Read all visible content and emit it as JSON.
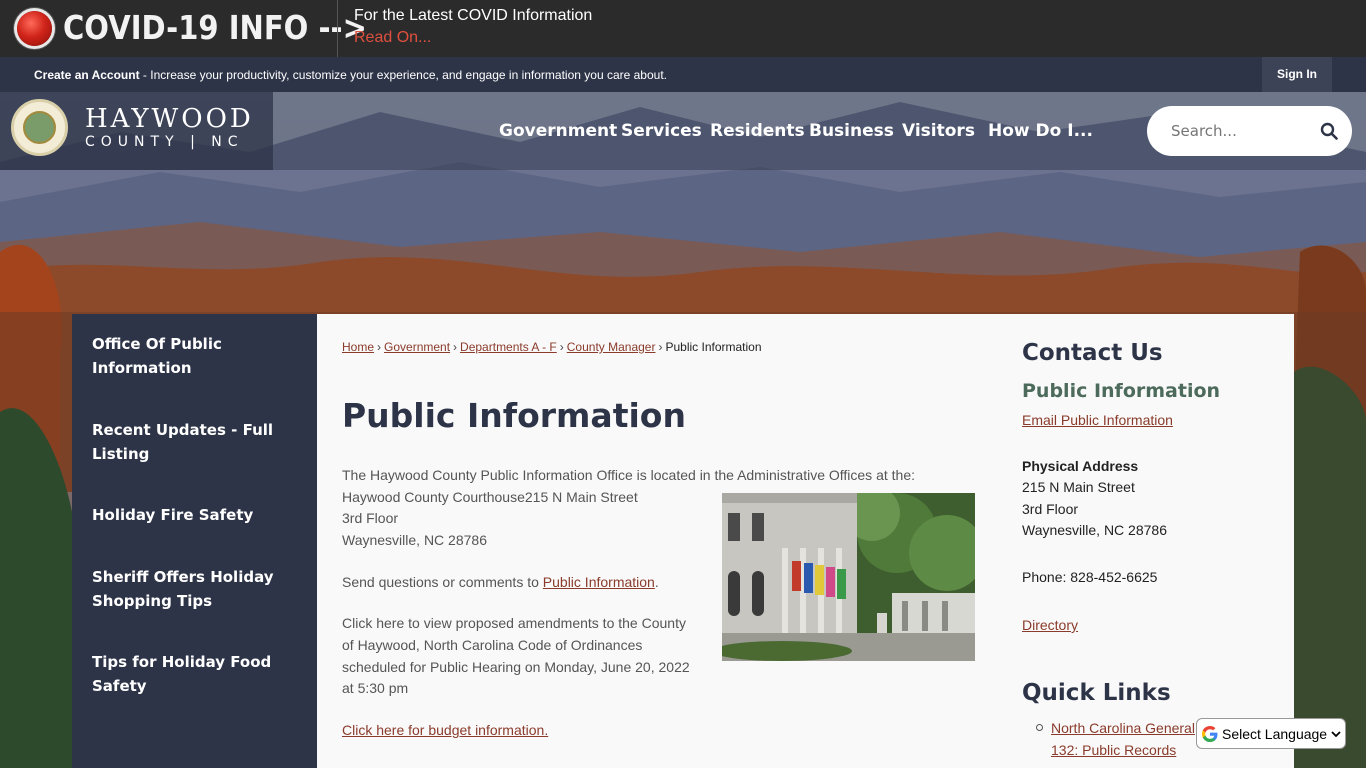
{
  "covid_banner": {
    "title": "COVID-19 INFO -->",
    "message": "For the Latest COVID Information",
    "read_on": "Read On..."
  },
  "account_bar": {
    "create_link": "Create an Account",
    "description": " - Increase your productivity, customize your experience, and engage in information you care about.",
    "sign_in": "Sign In"
  },
  "logo": {
    "name": "HAYWOOD",
    "subtitle": "COUNTY | NC"
  },
  "nav": {
    "items": [
      "Government",
      "Services",
      "Residents",
      "Business",
      "Visitors",
      "How Do I..."
    ]
  },
  "search": {
    "placeholder": "Search..."
  },
  "sidebar": {
    "items": [
      "Office Of Public Information",
      "Recent Updates - Full Listing",
      "Holiday Fire Safety",
      "Sheriff Offers Holiday Shopping Tips",
      "Tips for Holiday Food Safety"
    ]
  },
  "breadcrumb": {
    "items": [
      "Home",
      "Government",
      "Departments A - F",
      "County Manager"
    ],
    "current": "Public Information"
  },
  "main": {
    "title": "Public Information",
    "intro": "The Haywood County Public Information Office is located in the Administrative Offices at the:",
    "address_line1": "Haywood County Courthouse215 N Main Street",
    "address_line2": "3rd Floor",
    "address_line3": "Waynesville, NC 28786",
    "questions_prefix": "Send questions or comments to ",
    "questions_link": "Public Information",
    "questions_suffix": ".",
    "amendments_line1": "Click here to view proposed amendments to the County",
    "amendments_line2": "of Haywood, North Carolina Code of Ordinances",
    "amendments_line3": "scheduled for Public Hearing on Monday, June 20, 2022",
    "amendments_line4": "at 5:30 pm",
    "budget_link": "Click here for budget information."
  },
  "contact": {
    "title": "Contact Us",
    "subtitle": "Public Information",
    "email_link": "Email Public Information",
    "address_label": "Physical Address",
    "address_line1": "215 N Main Street",
    "address_line2": "3rd Floor",
    "address_line3": "Waynesville, NC 28786",
    "phone": "Phone: 828-452-6625",
    "directory_link": "Directory"
  },
  "quick_links": {
    "title": "Quick Links",
    "item1_line1": "North Carolina General",
    "item1_line2": "132: Public Records"
  },
  "translate": {
    "label": "Select Language"
  },
  "colors": {
    "navy": "#2e3448",
    "link": "#8a3b2b",
    "covid_read": "#e0503e",
    "green_heading": "#4d6b5c"
  }
}
